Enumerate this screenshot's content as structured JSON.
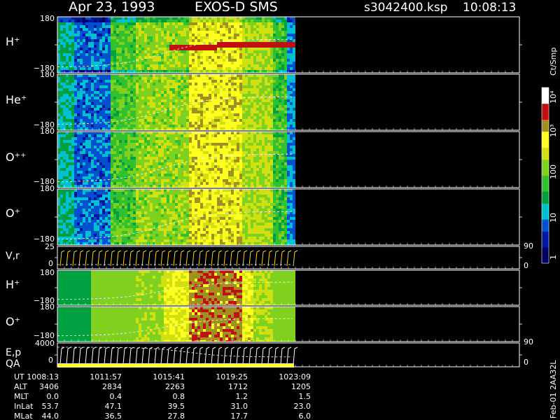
{
  "header": {
    "date": "Apr 23, 1993",
    "instrument": "EXOS-D SMS",
    "file": "s3042400.ksp",
    "time": "10:08:13"
  },
  "colorbar": {
    "unit": "Ct/Smp",
    "ticks": [
      "1",
      "10",
      "100",
      "10³",
      "10⁴"
    ]
  },
  "side_label": "Feb-01 2AA32L",
  "chart_data": {
    "type": "heatmap",
    "panels": [
      {
        "label": "H⁺",
        "ymax": "180",
        "ymin": "−180"
      },
      {
        "label": "He⁺",
        "ymax": "180",
        "ymin": "−180"
      },
      {
        "label": "O⁺⁺",
        "ymax": "180",
        "ymin": "−180"
      },
      {
        "label": "O⁺",
        "ymax": "180",
        "ymin": "−180"
      },
      {
        "label": "V,r",
        "ymax": "25",
        "ymin": "0",
        "right_top": "90",
        "right_bottom": "0"
      },
      {
        "label": "H⁺",
        "ymax": "180",
        "ymin": "−180"
      },
      {
        "label": "O⁺",
        "ymax": "180",
        "ymin": "−180"
      },
      {
        "label": "E,p",
        "label2": "QA",
        "ymax": "4000",
        "ymin": "0",
        "right_top": "90",
        "right_bottom": "0"
      }
    ],
    "x_axis": {
      "row_labels": [
        "UT",
        "ALT",
        "MLT",
        "InLat",
        "MLat"
      ],
      "columns": [
        [
          "1008:13",
          "3406",
          "0.0",
          "53.7",
          "44.0"
        ],
        [
          "1011:57",
          "2834",
          "0.4",
          "47.1",
          "36.5"
        ],
        [
          "1015:41",
          "2263",
          "0.8",
          "39.5",
          "27.8"
        ],
        [
          "1019:25",
          "1712",
          "1.2",
          "31.0",
          "17.7"
        ],
        [
          "1023:09",
          "1205",
          "1.5",
          "23.0",
          "6.0"
        ]
      ]
    }
  }
}
